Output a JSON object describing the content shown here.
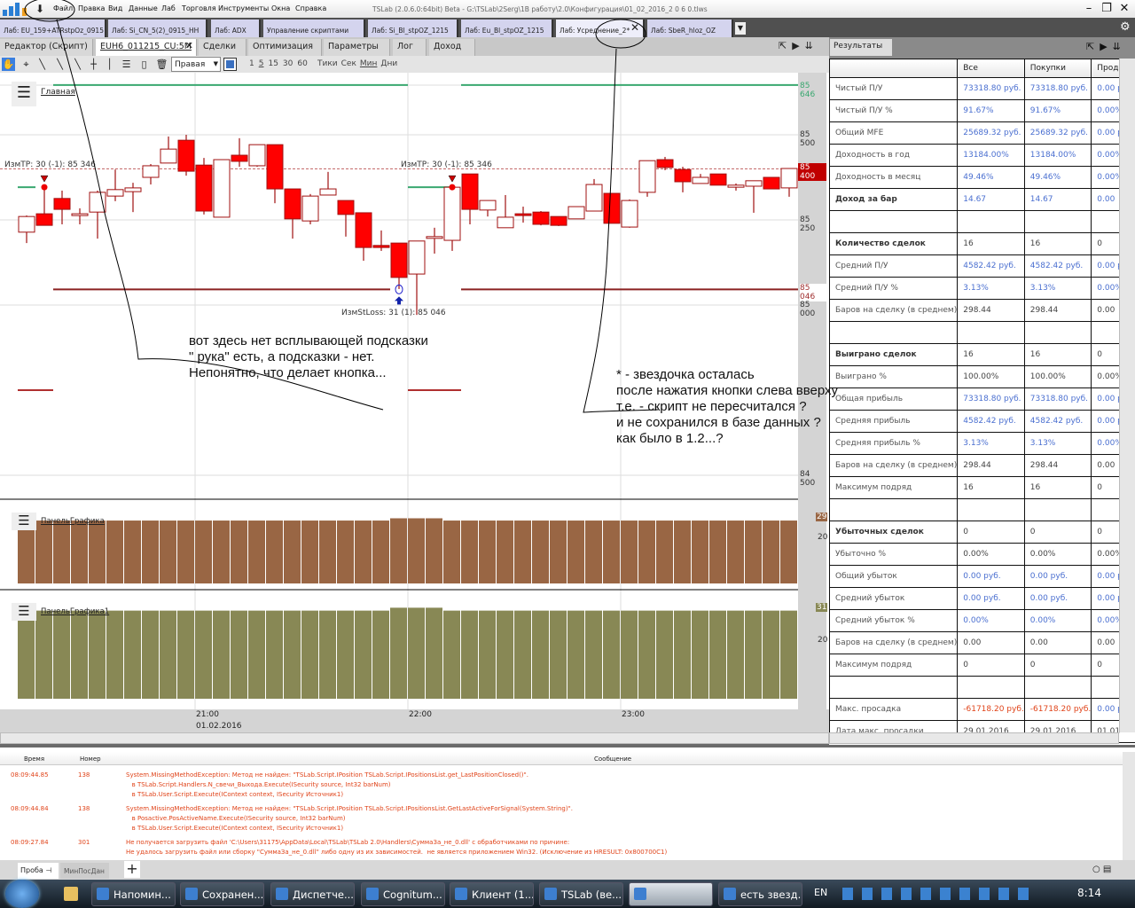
{
  "app": {
    "title": "TSLab (2.0.6.0:64bit) Beta - G:\\TSLab\\2Serg\\1B работу\\2.0\\Конфигурация\\01_02_2016_2 0 6 0.tlws",
    "menu": [
      "Файл",
      "Правка",
      "Вид",
      "Данные",
      "Лаб",
      "Торговля",
      "Инструменты",
      "Окна",
      "Справка"
    ]
  },
  "doc_tabs": [
    "Лаб: EU_159+ATRstpOz_0915",
    "Лаб: Si_CN_5(2)_0915_HH",
    "Лаб: ADX",
    "Управление скриптами",
    "Лаб: Si_Bl_stpOZ_1215",
    "Лаб: Eu_Bl_stpOZ_1215",
    "Лаб: Усреднение_2*",
    "Лаб: SbeR_hloz_OZ"
  ],
  "sub_tabs": [
    "Редактор (Скрипт)",
    "EUH6_011215_CU:5M",
    "Сделки",
    "Оптимизация",
    "Параметры",
    "Лог",
    "Доход"
  ],
  "toolbar": {
    "axis_select": "Правая",
    "intervals": [
      "1",
      "5",
      "15",
      "30",
      "60"
    ],
    "units": [
      "Тики",
      "Сек",
      "Мин",
      "Дни"
    ]
  },
  "chart": {
    "pane_title": "Главная",
    "tp_label": "ИзмTP: 30 (-1): 85 346",
    "sl_label": "ИзмStLoss: 31 (1): 85 046",
    "price_labels": [
      "85 500",
      "85 250",
      "85 000",
      "84 500"
    ],
    "tp_level": "85 646",
    "last_price": "85 400",
    "sl_level": "85 046",
    "time_labels": [
      "21:00",
      "22:00",
      "23:00"
    ],
    "date_label": "01.02.2016",
    "panel1_title": "ПанельГрафика",
    "panel1_last": "29",
    "panel1_tick": "20",
    "panel2_title": "ПанельГрафика1",
    "panel2_last": "31",
    "panel2_tick": "20",
    "colors": {
      "up_border": "#a01010",
      "down_fill": "#ff0000",
      "tp_line": "#3aa870",
      "sl_line": "#8b2222",
      "panel1": "#996644",
      "panel2": "#888855"
    }
  },
  "chart_data": {
    "type": "candlestick",
    "ylim": [
      84450,
      85700
    ],
    "ohlc": [
      [
        85214,
        85263,
        85182,
        85260
      ],
      [
        85268,
        85349,
        85234,
        85234
      ],
      [
        85313,
        85336,
        85237,
        85281
      ],
      [
        85268,
        85284,
        85237,
        85268
      ],
      [
        85273,
        85336,
        85195,
        85331
      ],
      [
        85320,
        85398,
        85305,
        85339
      ],
      [
        85333,
        85359,
        85273,
        85344
      ],
      [
        85375,
        85414,
        85354,
        85409
      ],
      [
        85417,
        85495,
        85417,
        85458
      ],
      [
        85484,
        85500,
        85380,
        85393
      ],
      [
        85411,
        85432,
        85266,
        85276
      ],
      [
        85258,
        85427,
        85258,
        85427
      ],
      [
        85440,
        85490,
        85406,
        85422
      ],
      [
        85409,
        85471,
        85406,
        85471
      ],
      [
        85471,
        85471,
        85299,
        85341
      ],
      [
        85341,
        85341,
        85195,
        85253
      ],
      [
        85247,
        85326,
        85237,
        85320
      ],
      [
        85323,
        85391,
        85323,
        85341
      ],
      [
        85307,
        85307,
        85201,
        85266
      ],
      [
        85271,
        85271,
        85130,
        85169
      ],
      [
        85175,
        85219,
        85159,
        85169
      ],
      [
        85182,
        85182,
        85047,
        85081
      ],
      [
        85091,
        85188,
        84971,
        85188
      ],
      [
        85201,
        85227,
        85151,
        85201
      ],
      [
        85190,
        85346,
        85159,
        85346
      ],
      [
        85385,
        85385,
        85237,
        85281
      ],
      [
        85279,
        85307,
        85260,
        85307
      ],
      [
        85227,
        85323,
        85227,
        85258
      ],
      [
        85268,
        85289,
        85242,
        85263
      ],
      [
        85273,
        85276,
        85234,
        85237
      ],
      [
        85260,
        85260,
        85232,
        85234
      ],
      [
        85253,
        85289,
        85253,
        85289
      ],
      [
        85276,
        85370,
        85276,
        85354
      ],
      [
        85328,
        85328,
        85240,
        85240
      ],
      [
        85229,
        85310,
        85227,
        85307
      ],
      [
        85331,
        85424,
        85318,
        85424
      ],
      [
        85427,
        85435,
        85396,
        85404
      ],
      [
        85398,
        85406,
        85331,
        85362
      ],
      [
        85357,
        85385,
        85357,
        85375
      ],
      [
        85385,
        85385,
        85352,
        85352
      ],
      [
        85346,
        85357,
        85336,
        85352
      ],
      [
        85349,
        85365,
        85271,
        85365
      ],
      [
        85375,
        85375,
        85341,
        85341
      ],
      [
        85344,
        85401,
        85318,
        85401
      ]
    ],
    "tp_level": 85646,
    "tp_prev": 85346,
    "sl_level": 85046,
    "lower_level": 84750,
    "current_line": 85400,
    "panel1_values": [
      29,
      29,
      29,
      29,
      29,
      29,
      29,
      29,
      29,
      29,
      29,
      29,
      29,
      29,
      29,
      29,
      29,
      29,
      29,
      29,
      29,
      30,
      30,
      30,
      29,
      29,
      29,
      29,
      29,
      29,
      29,
      29,
      29,
      29,
      29,
      29,
      29,
      29,
      29,
      29,
      29,
      29,
      29,
      29
    ],
    "panel2_values": [
      31,
      31,
      31,
      31,
      31,
      31,
      31,
      31,
      31,
      31,
      31,
      31,
      31,
      31,
      31,
      31,
      31,
      31,
      31,
      31,
      31,
      32,
      32,
      32,
      31,
      31,
      31,
      31,
      31,
      31,
      31,
      31,
      31,
      31,
      31,
      31,
      31,
      31,
      31,
      31,
      31,
      31,
      31,
      31
    ]
  },
  "results": {
    "tab": "Результаты",
    "columns": [
      "",
      "Все",
      "Покупки",
      "Прод"
    ],
    "rows": [
      [
        "Чистый П/У",
        "73318.80 руб.",
        "73318.80 руб.",
        "0.00 руб.",
        "blue",
        ""
      ],
      [
        "Чистый П/У %",
        "91.67%",
        "91.67%",
        "0.00%",
        "blue",
        ""
      ],
      [
        "Общий MFE",
        "25689.32 руб.",
        "25689.32 руб.",
        "0.00 руб.",
        "blue",
        ""
      ],
      [
        "Доходность в год",
        "13184.00%",
        "13184.00%",
        "0.00%",
        "blue",
        ""
      ],
      [
        "Доходность в месяц",
        "49.46%",
        "49.46%",
        "0.00%",
        "blue",
        ""
      ],
      [
        "Доход за бар",
        "14.67",
        "14.67",
        "0.00",
        "blue",
        "b"
      ],
      [
        "",
        "",
        "",
        "",
        "",
        ""
      ],
      [
        "Количество сделок",
        "16",
        "16",
        "0",
        "blk",
        "b"
      ],
      [
        "Средний П/У",
        "4582.42 руб.",
        "4582.42 руб.",
        "0.00 руб.",
        "blue",
        ""
      ],
      [
        "Средний П/У %",
        "3.13%",
        "3.13%",
        "0.00%",
        "blue",
        ""
      ],
      [
        "Баров на сделку (в среднем)",
        "298.44",
        "298.44",
        "0.00",
        "blk",
        ""
      ],
      [
        "",
        "",
        "",
        "",
        "",
        ""
      ],
      [
        "Выиграно сделок",
        "16",
        "16",
        "0",
        "blk",
        "b"
      ],
      [
        "Выиграно %",
        "100.00%",
        "100.00%",
        "0.00%",
        "blk",
        ""
      ],
      [
        "Общая прибыль",
        "73318.80 руб.",
        "73318.80 руб.",
        "0.00 руб.",
        "blue",
        ""
      ],
      [
        "Средняя прибыль",
        "4582.42 руб.",
        "4582.42 руб.",
        "0.00 руб.",
        "blue",
        ""
      ],
      [
        "Средняя прибыль %",
        "3.13%",
        "3.13%",
        "0.00%",
        "blue",
        ""
      ],
      [
        "Баров на сделку (в среднем)",
        "298.44",
        "298.44",
        "0.00",
        "blk",
        ""
      ],
      [
        "Максимум подряд",
        "16",
        "16",
        "0",
        "blk",
        ""
      ],
      [
        "",
        "",
        "",
        "",
        "",
        ""
      ],
      [
        "Убыточных сделок",
        "0",
        "0",
        "0",
        "blk",
        "b"
      ],
      [
        "Убыточно %",
        "0.00%",
        "0.00%",
        "0.00%",
        "blk",
        ""
      ],
      [
        "Общий убыток",
        "0.00 руб.",
        "0.00 руб.",
        "0.00 руб.",
        "blue",
        ""
      ],
      [
        "Средний убыток",
        "0.00 руб.",
        "0.00 руб.",
        "0.00 руб.",
        "blue",
        ""
      ],
      [
        "Средний убыток %",
        "0.00%",
        "0.00%",
        "0.00%",
        "blue",
        ""
      ],
      [
        "Баров на сделку (в среднем)",
        "0.00",
        "0.00",
        "0.00",
        "blk",
        ""
      ],
      [
        "Максимум подряд",
        "0",
        "0",
        "0",
        "blk",
        ""
      ],
      [
        "",
        "",
        "",
        "",
        "",
        ""
      ],
      [
        "Макс. просадка",
        "-61718.20 руб.",
        "-61718.20 руб.",
        "0.00 руб.",
        "red",
        ""
      ],
      [
        "Дата макс. просадки",
        "29.01.2016",
        "29.01.2016",
        "01.01",
        "blk",
        ""
      ]
    ]
  },
  "log": {
    "headers": [
      "Время",
      "Номер",
      "Сообщение"
    ],
    "entries": [
      {
        "time": "08:09:44.85",
        "num": "138",
        "lines": [
          "System.MissingMethodException: Метод не найден: \"TSLab.Script.IPosition TSLab.Script.IPositionsList.get_LastPositionClosed()\".",
          "   в TSLab.Script.Handlers.N_свечи_Выхода.Execute(ISecurity source, Int32 barNum)",
          "   в TSLab.User.Script.Execute(IContext context, ISecurity Источник1)"
        ]
      },
      {
        "time": "08:09:44.84",
        "num": "138",
        "lines": [
          "System.MissingMethodException: Метод не найден: \"TSLab.Script.IPosition TSLab.Script.IPositionsList.GetLastActiveForSignal(System.String)\".",
          "   в Posactive.PosActiveName.Execute(ISecurity source, Int32 barNum)",
          "   в TSLab.User.Script.Execute(IContext context, ISecurity Источник1)"
        ]
      },
      {
        "time": "08:09:27.84",
        "num": "301",
        "lines": [
          "Не получается загрузить файл 'C:\\Users\\31175\\AppData\\Local\\TSLab\\TSLab 2.0\\Handlers\\СуммаЗа_не_0.dll' с обработчиками по причине:",
          "Не удалось загрузить файл или сборку \"СуммаЗа_не_0.dll\" либо одну из их зависимостей.  не является приложением Win32. (Исключение из HRESULT: 0x800700C1)"
        ]
      }
    ]
  },
  "bottom_tabs": [
    "Проба",
    "МинПосДан"
  ],
  "annotations": {
    "note1": "вот здесь нет всплывающей подсказки\n\" рука\" есть, а подсказки - нет.\nНепонятно, что делает кнопка...",
    "note2": "* - звездочка осталась\nпосле нажатия кнопки слева вверху\nт.е. - скрипт не пересчитался ?\nи не сохранился в базе данных ?\nкак было в 1.2...?"
  },
  "taskbar": {
    "items": [
      "Напомин...",
      "Сохранен...",
      "Диспетче...",
      "Cognitum...",
      "Клиент (1...",
      "TSLab (ве...",
      "",
      "есть звезд..."
    ],
    "lang": "EN",
    "clock": "8:14"
  }
}
